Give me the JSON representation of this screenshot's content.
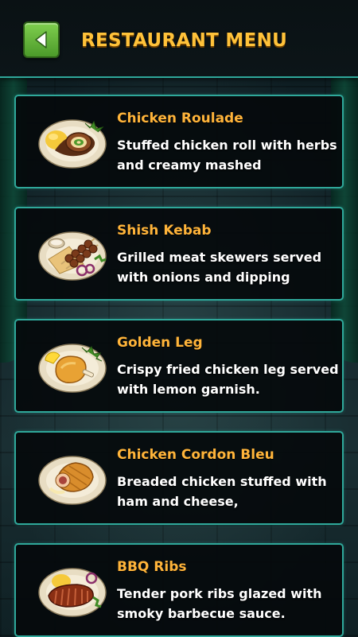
{
  "header": {
    "title": "RESTAURANT MENU",
    "back_icon": "back-arrow-icon"
  },
  "colors": {
    "accent_border": "#2fa89a",
    "title": "#ffc23a",
    "dish_name": "#ffb43a",
    "back_button": "#5cb032"
  },
  "menu": {
    "items": [
      {
        "name": "Chicken Roulade",
        "description": "Stuffed chicken roll with herbs and creamy mashed",
        "image": "chicken-roulade-plate-icon"
      },
      {
        "name": "Shish Kebab",
        "description": "Grilled meat skewers served with onions and dipping",
        "image": "shish-kebab-plate-icon"
      },
      {
        "name": "Golden Leg",
        "description": "Crispy fried chicken leg served with lemon garnish.",
        "image": "golden-leg-plate-icon"
      },
      {
        "name": "Chicken Cordon Bleu",
        "description": "Breaded chicken stuffed with ham and cheese,",
        "image": "cordon-bleu-plate-icon"
      },
      {
        "name": "BBQ Ribs",
        "description": "Tender pork ribs glazed with smoky barbecue sauce.",
        "image": "bbq-ribs-plate-icon"
      }
    ]
  }
}
